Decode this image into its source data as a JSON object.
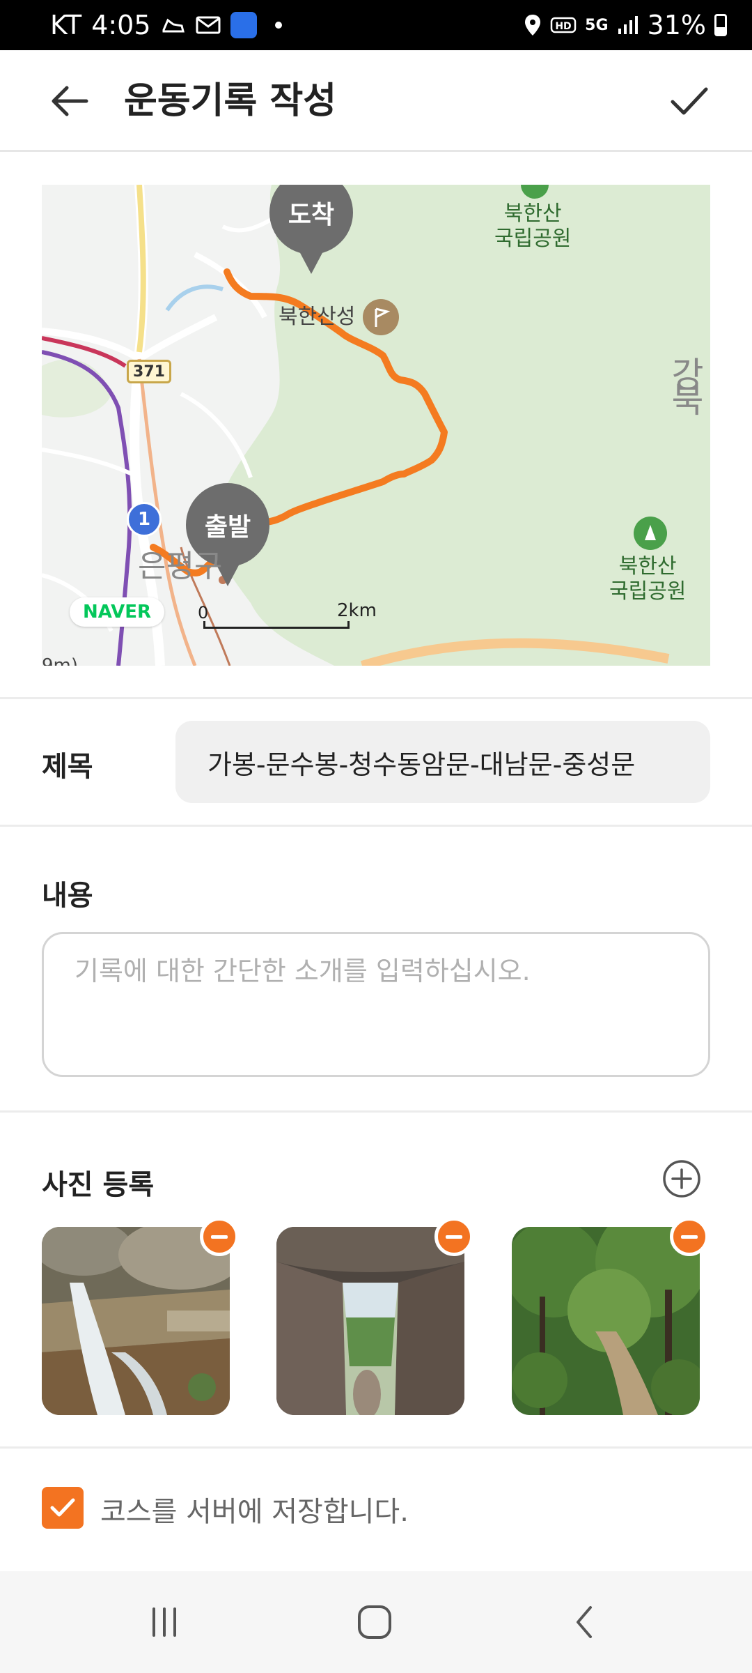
{
  "status_bar": {
    "carrier": "KT",
    "time": "4:05",
    "network": "5G",
    "battery": "31%"
  },
  "app_bar": {
    "title": "운동기록 작성"
  },
  "map": {
    "start_pin": "출발",
    "end_pin": "도착",
    "labels": {
      "park_top": "북한산\n국립공원",
      "park_right": "북한산\n국립공원",
      "fortress": "북한산성",
      "district": "은평구",
      "partial_right": "강북",
      "partial_bottom_left": "9m)"
    },
    "road_number": "371",
    "route_number": "1",
    "brand": "NAVER",
    "scale_start": "0",
    "scale_end": "2km",
    "route_color": "#f47b20"
  },
  "form": {
    "title_label": "제목",
    "title_value": "가봉-문수봉-청수동암문-대남문-중성문",
    "content_label": "내용",
    "content_placeholder": "기록에 대한 간단한 소개를 입력하십시오.",
    "photos_label": "사진 등록",
    "photos": [
      {
        "name": "waterfall-rocks"
      },
      {
        "name": "rock-crevice"
      },
      {
        "name": "forest-trail"
      }
    ],
    "save_course_label": "코스를 서버에 저장합니다.",
    "save_course_checked": true
  },
  "colors": {
    "accent": "#f37321"
  }
}
